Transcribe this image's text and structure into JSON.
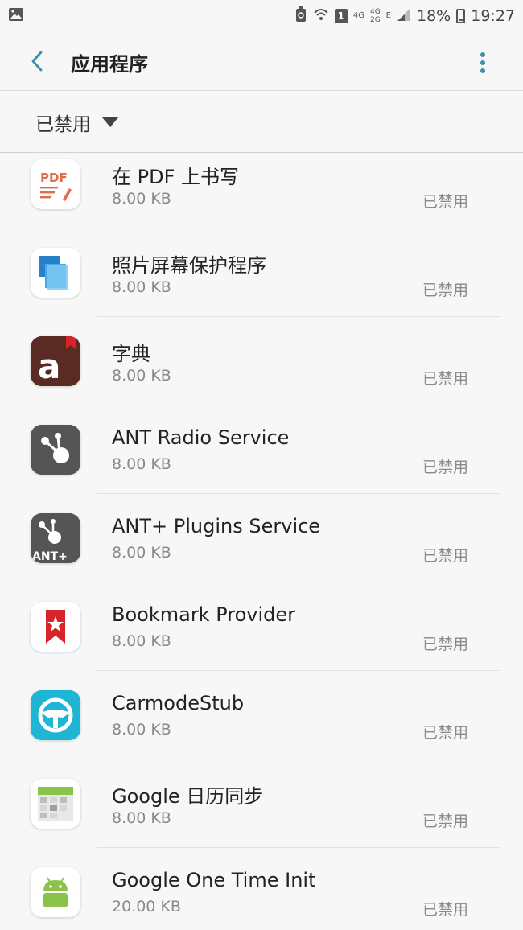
{
  "status_bar": {
    "sim_badge": "1",
    "net_4g": "4G",
    "net_4g_top": "4G",
    "net_2g": "2G",
    "net_e": "E",
    "battery": "18%",
    "time": "19:27"
  },
  "app_bar": {
    "title": "应用程序"
  },
  "filter": {
    "label": "已禁用"
  },
  "apps": [
    {
      "name": "在 PDF 上书写",
      "size": "8.00 KB",
      "status": "已禁用",
      "icon": "pdf-write-icon"
    },
    {
      "name": "照片屏幕保护程序",
      "size": "8.00 KB",
      "status": "已禁用",
      "icon": "photo-screensaver-icon"
    },
    {
      "name": "字典",
      "size": "8.00 KB",
      "status": "已禁用",
      "icon": "dictionary-icon"
    },
    {
      "name": "ANT Radio Service",
      "size": "8.00 KB",
      "status": "已禁用",
      "icon": "ant-radio-icon"
    },
    {
      "name": "ANT+ Plugins Service",
      "size": "8.00 KB",
      "status": "已禁用",
      "icon": "ant-plugins-icon"
    },
    {
      "name": "Bookmark Provider",
      "size": "8.00 KB",
      "status": "已禁用",
      "icon": "bookmark-icon"
    },
    {
      "name": "CarmodeStub",
      "size": "8.00 KB",
      "status": "已禁用",
      "icon": "carmode-icon"
    },
    {
      "name": "Google 日历同步",
      "size": "8.00 KB",
      "status": "已禁用",
      "icon": "calendar-sync-icon"
    },
    {
      "name": "Google One Time Init",
      "size": "20.00 KB",
      "status": "已禁用",
      "icon": "android-icon"
    }
  ],
  "icon_labels": {
    "pdf": "PDF",
    "dictionary": "a",
    "ant": "ANT+"
  }
}
